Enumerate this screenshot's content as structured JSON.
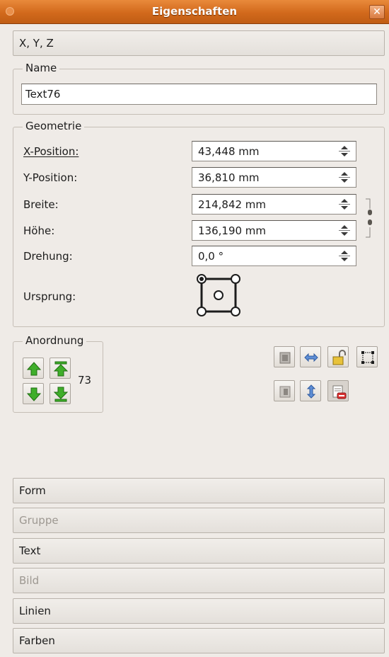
{
  "window": {
    "title": "Eigenschaften",
    "close_glyph": "✕"
  },
  "sections": {
    "xyz": {
      "label": "X, Y, Z"
    },
    "form": {
      "label": "Form"
    },
    "gruppe": {
      "label": "Gruppe"
    },
    "text": {
      "label": "Text"
    },
    "bild": {
      "label": "Bild"
    },
    "linien": {
      "label": "Linien"
    },
    "farben": {
      "label": "Farben"
    }
  },
  "name_group": {
    "label": "Name",
    "value": "Text76"
  },
  "geometry": {
    "label": "Geometrie",
    "fields": [
      {
        "label": "X-Position:",
        "value": "43,448 mm"
      },
      {
        "label": "Y-Position:",
        "value": "36,810 mm"
      },
      {
        "label": "Breite:",
        "value": "214,842 mm"
      },
      {
        "label": "Höhe:",
        "value": "136,190 mm"
      },
      {
        "label": "Drehung:",
        "value": "0,0 °"
      }
    ],
    "origin_label": "Ursprung:"
  },
  "arrangement": {
    "label": "Anordnung",
    "level": "73"
  },
  "icons": {
    "raise": "arrow-up-icon",
    "raise_to_top": "arrow-to-top-icon",
    "lower": "arrow-down-icon",
    "lower_to_bottom": "arrow-to-bottom-icon",
    "flip_horizontal": "flip-horizontal-icon",
    "flip_vertical": "flip-vertical-icon",
    "lock": "lock-icon",
    "size_lock": "size-lock-icon",
    "no_print": "no-print-icon",
    "chain": "chain-link-icon"
  },
  "colors": {
    "titlebar": "#d2691c",
    "arrow_green": "#3fae2a"
  }
}
